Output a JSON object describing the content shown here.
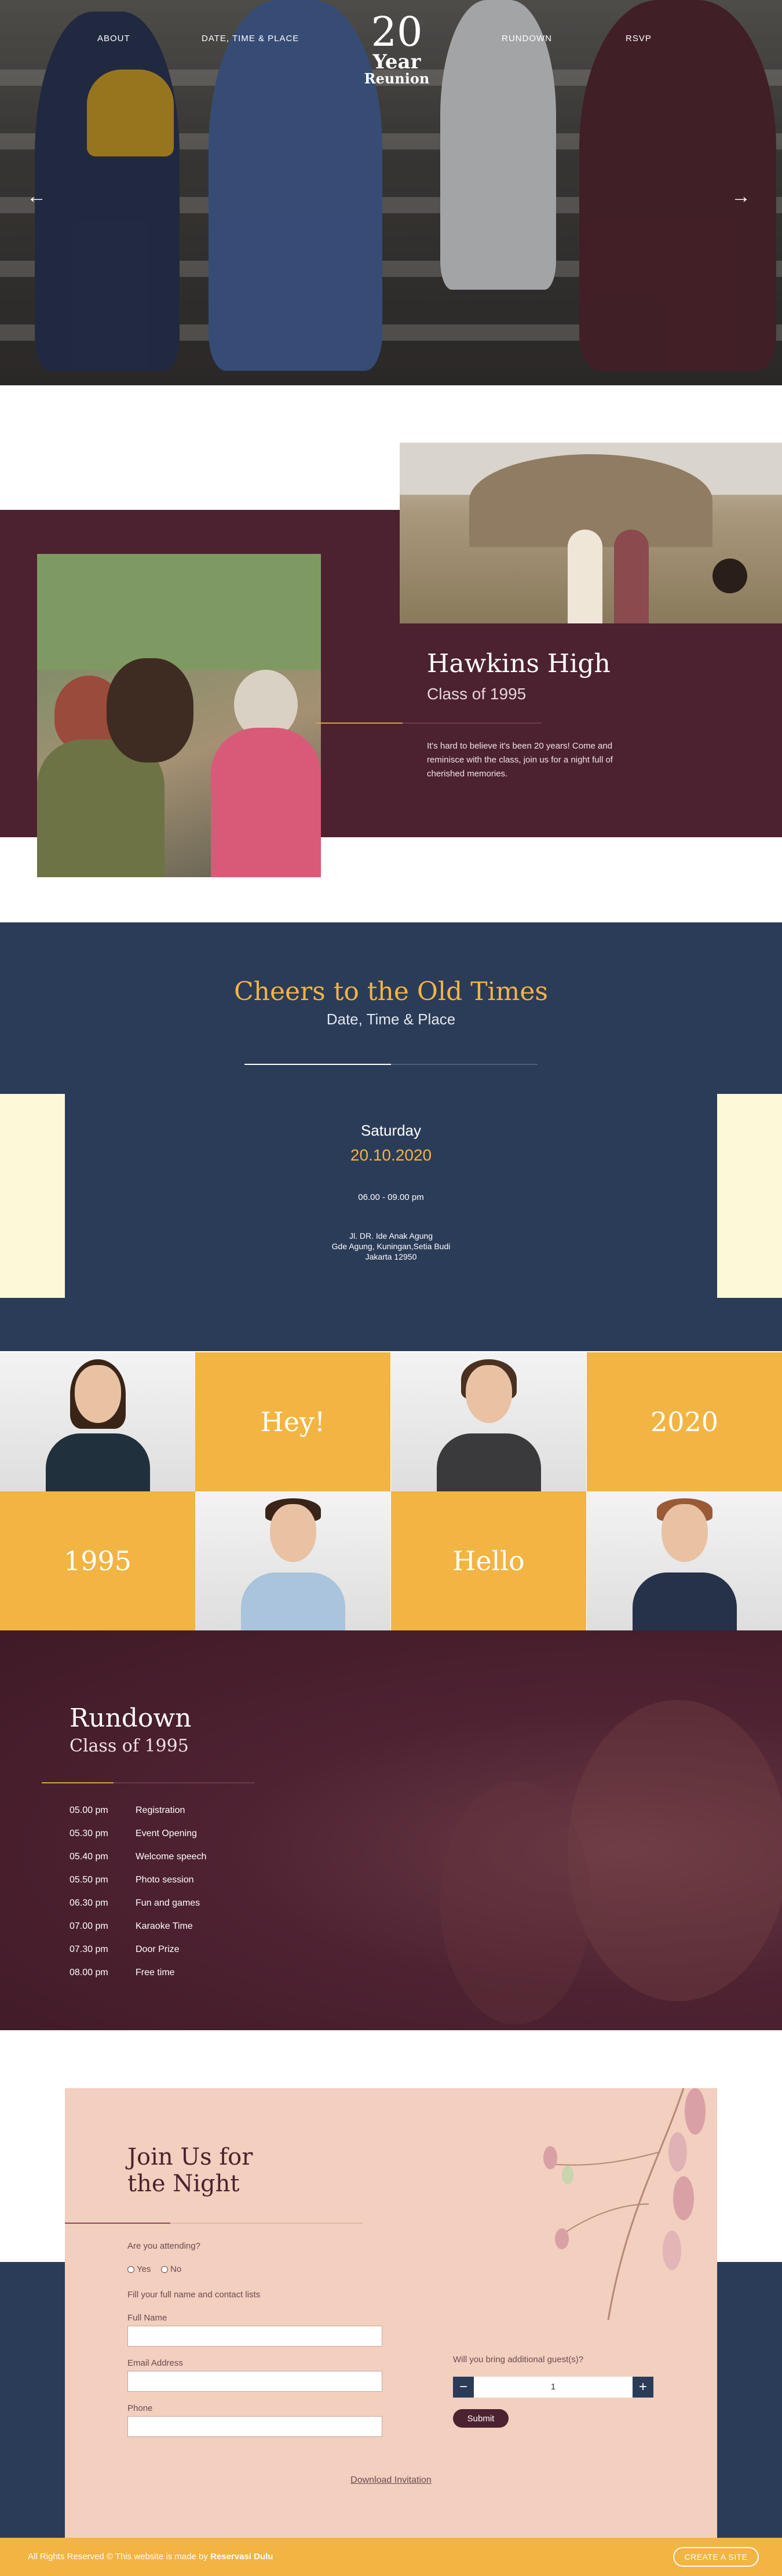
{
  "nav": {
    "items": [
      "ABOUT",
      "DATE, TIME & PLACE",
      "RUNDOWN",
      "RSVP"
    ],
    "logo": {
      "number": "20",
      "year": "Year",
      "reunion": "Reunion"
    }
  },
  "hero": {
    "prev_icon": "arrow-left-icon",
    "next_icon": "arrow-right-icon"
  },
  "about": {
    "title": "Hawkins High",
    "subtitle": "Class of 1995",
    "text": "It's hard to believe it's been 20 years! Come and reminisce with the class, join us for a night full of cherished memories."
  },
  "cheers": {
    "title": "Cheers to the Old Times",
    "subtitle": "Date, Time & Place",
    "day": "Saturday",
    "date": "20.10.2020",
    "time": "06.00 - 09.00 pm",
    "address": [
      "Jl. DR. Ide Anak Agung",
      "Gde Agung, Kuningan,Setia Budi",
      "Jakarta 12950"
    ]
  },
  "grid": {
    "words": [
      "Hey!",
      "2020",
      "1995",
      "Hello"
    ]
  },
  "rundown": {
    "title": "Rundown",
    "subtitle": "Class of 1995",
    "items": [
      {
        "time": "05.00 pm",
        "event": "Registration"
      },
      {
        "time": "05.30 pm",
        "event": "Event Opening"
      },
      {
        "time": "05.40 pm",
        "event": "Welcome speech"
      },
      {
        "time": "05.50 pm",
        "event": "Photo session"
      },
      {
        "time": "06.30 pm",
        "event": "Fun and games"
      },
      {
        "time": "07.00 pm",
        "event": "Karaoke Time"
      },
      {
        "time": "07.30 pm",
        "event": "Door Prize"
      },
      {
        "time": "08.00 pm",
        "event": "Free time"
      }
    ]
  },
  "rsvp": {
    "title_line1": "Join Us for",
    "title_line2": "the Night",
    "attending_label": "Are you attending?",
    "yes": "Yes",
    "no": "No",
    "contact_label": "Fill your full name and contact lists",
    "full_name_label": "Full Name",
    "email_label": "Email Address",
    "phone_label": "Phone",
    "guests_label": "Will you bring additional guest(s)?",
    "guests_value": "1",
    "minus": "−",
    "plus": "+",
    "submit": "Submit",
    "download": "Download Invitation"
  },
  "footer": {
    "text_prefix": "All Rights Reserved © This website is made by ",
    "brand": "Reservasi Dulu",
    "cta": "CREATE A SITE"
  },
  "colors": {
    "maroon": "#4c2130",
    "navy": "#2b3c58",
    "gold": "#f2b443",
    "peach": "#f2cfbe",
    "cream": "#fdf8d8"
  }
}
